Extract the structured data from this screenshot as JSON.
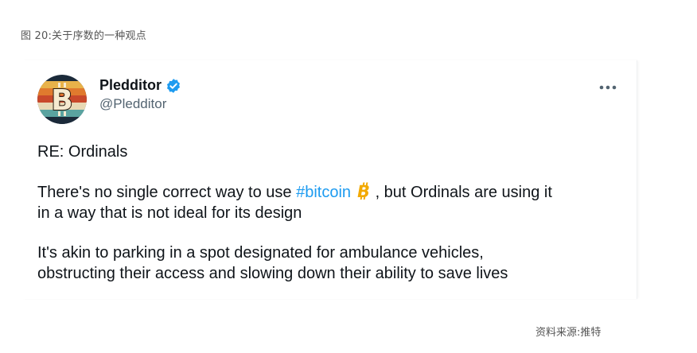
{
  "figure_caption": "图 20:关于序数的一种观点",
  "tweet": {
    "author": {
      "display_name": "Pledditor",
      "handle": "@Pledditor",
      "avatar_icon": "bitcoin-retro-avatar-icon",
      "verified_icon": "verified-badge-icon"
    },
    "more_icon": "more-dots-icon",
    "text": {
      "line1": "RE: Ordinals",
      "p2_before": "There's no single correct way to use ",
      "p2_hashtag": "#bitcoin",
      "p2_emoji": "bitcoin-emoji-icon",
      "p2_after": " , but Ordinals are using it",
      "p2_line2": "in a way that is not ideal for its design",
      "p3_line1": "It's akin to parking in a spot designated for ambulance vehicles,",
      "p3_line2": "obstructing their access and slowing down their ability to save lives"
    },
    "colors": {
      "hashtag": "#1d9bf0",
      "verified": "#1d9bf0",
      "handle": "#536471",
      "bitcoin_orange": "#f2a900"
    }
  },
  "source_caption": "资料来源:推特"
}
